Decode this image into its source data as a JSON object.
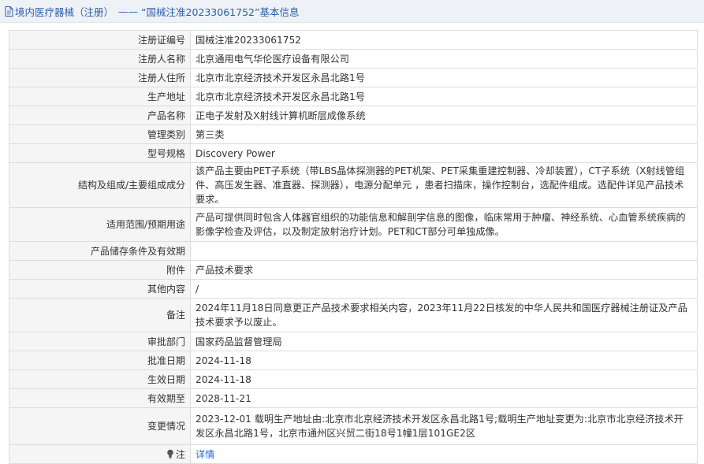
{
  "breadcrumb": {
    "category": "境内医疗器械（注册）",
    "separator": "——",
    "title": "“国械注准20233061752”基本信息"
  },
  "fields": [
    {
      "label": "注册证编号",
      "value": "国械注准20233061752"
    },
    {
      "label": "注册人名称",
      "value": "北京通用电气华伦医疗设备有限公司"
    },
    {
      "label": "注册人住所",
      "value": "北京市北京经济技术开发区永昌北路1号"
    },
    {
      "label": "生产地址",
      "value": "北京市北京经济技术开发区永昌北路1号"
    },
    {
      "label": "产品名称",
      "value": "正电子发射及X射线计算机断层成像系统"
    },
    {
      "label": "管理类别",
      "value": "第三类"
    },
    {
      "label": "型号规格",
      "value": "Discovery Power"
    },
    {
      "label": "结构及组成/主要组成成分",
      "value": "该产品主要由PET子系统（带LBS晶体探测器的PET机架、PET采集重建控制器、冷却装置），CT子系统（X射线管组件、高压发生器、准直器、探测器），电源分配单元 ，患者扫描床，操作控制台，选配件组成。选配件详见产品技术要求。"
    },
    {
      "label": "适用范围/预期用途",
      "value": "产品可提供同时包含人体器官组织的功能信息和解剖学信息的图像，临床常用于肿瘤、神经系统、心血管系统疾病的影像学检查及评估，以及制定放射治疗计划。PET和CT部分可单独成像。"
    },
    {
      "label": "产品储存条件及有效期",
      "value": ""
    },
    {
      "label": "附件",
      "value": "产品技术要求"
    },
    {
      "label": "其他内容",
      "value": "/"
    },
    {
      "label": "备注",
      "value": "2024年11月18日同意更正产品技术要求相关内容，2023年11月22日核发的中华人民共和国医疗器械注册证及产品技术要求予以废止。"
    },
    {
      "label": "审批部门",
      "value": "国家药品监督管理局"
    },
    {
      "label": "批准日期",
      "value": "2024-11-18"
    },
    {
      "label": "生效日期",
      "value": "2024-11-18"
    },
    {
      "label": "有效期至",
      "value": "2028-11-21"
    },
    {
      "label": "变更情况",
      "value": "2023-12-01 载明生产地址由:北京市北京经济技术开发区永昌北路1号;载明生产地址变更为:北京市北京经济技术开发区永昌北路1号，北京市通州区兴贸二街18号1幢1层101GE2区"
    }
  ],
  "note": {
    "label": "注",
    "link_text": "详情",
    "icon": "lightbulb-icon"
  },
  "colors": {
    "accent": "#2a5ea8",
    "label_bg": "#f5f5f5",
    "border": "#dcdcdc"
  }
}
